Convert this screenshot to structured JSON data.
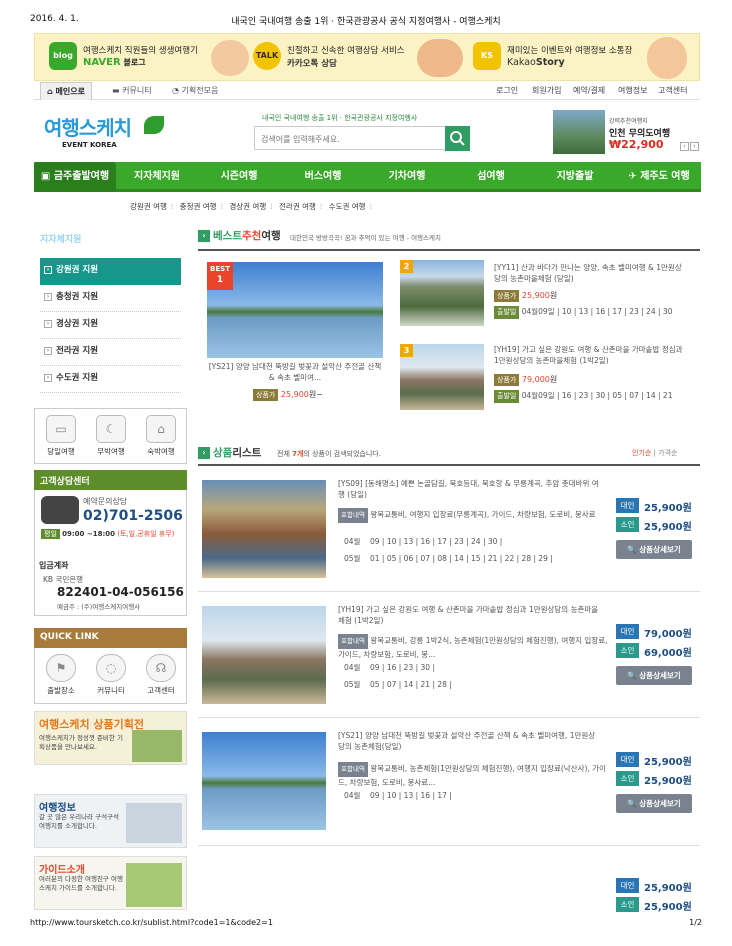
{
  "print": {
    "date": "2016. 4. 1.",
    "title": "내국인 국내여행 송출 1위 · 한국관광공사 공식 지정여행사 - 여행스케치",
    "url": "http://www.toursketch.co.kr/sublist.html?code1=1&code2=1",
    "page": "1/2"
  },
  "banner": [
    {
      "icon": "blog",
      "line1": "여행스케치 직원들의 생생여행기",
      "line2a": "NAVER",
      "line2b": " 블로그",
      "color": "#3aa82a"
    },
    {
      "icon": "TALK",
      "line1": "친절하고 신속한 여행상담 서비스",
      "line2a": "카카오톡",
      "line2b": " 상담",
      "color": "#222"
    },
    {
      "icon": "KS",
      "line1": "재미있는 이벤트와 여행정보 소통장",
      "line2a": "Kakao",
      "line2b": "Story",
      "color": "#222"
    }
  ],
  "topnav": {
    "tabs": [
      "메인으로",
      "커뮤니티",
      "기획전모음"
    ],
    "util": [
      "로그인",
      "회원가입",
      "예약/결제",
      "여행정보",
      "고객센터"
    ]
  },
  "logo": {
    "main": "여행스케치",
    "sub": "EVENT KOREA"
  },
  "search": {
    "caption": "내국인 국내여행 송출 1위 · 한국관광공사 지정여행사",
    "placeholder": "검색어를 입력해주세요."
  },
  "ad": {
    "line1": "강력추천여행지",
    "line2": "인천 무의도여행",
    "price": "₩22,900"
  },
  "gnav": [
    "금주출발여행",
    "지자체지원",
    "시즌여행",
    "버스여행",
    "기차여행",
    "섬여행",
    "지방출발",
    "제주도 여행"
  ],
  "subnav": [
    "강원권 여행",
    "충청권 여행",
    "경상권 여행",
    "전라권 여행",
    "수도권 여행"
  ],
  "lnb": {
    "title": "지자체지원",
    "items": [
      "강원권 지원",
      "충청권 지원",
      "경상권 지원",
      "전라권 지원",
      "수도권 지원"
    ]
  },
  "quick3": [
    "당일여행",
    "무박여행",
    "숙박여행"
  ],
  "cs": {
    "head": "고객상담센터",
    "label": "예약문의상담",
    "phone": "02)701-2506",
    "hours_tag": "평일",
    "hours": "09:00 ~18:00",
    "hours_note": "(토,일,공휴일 휴무)",
    "bank_title": "입금계좌",
    "bank": "KB 국민은행",
    "account": "822401-04-056156",
    "holder": "예금주 : (주)여행스케치여행사"
  },
  "quicklink": {
    "head": "QUICK LINK",
    "items": [
      "출발장소",
      "커뮤니티",
      "고객센터"
    ]
  },
  "promos": [
    {
      "title": "여행스케치 상품기획전",
      "desc": "여행스케치가 정성껏 준비한 기획상품을 만나보세요."
    },
    {
      "title": "여행정보",
      "desc": "갈 곳 많은 우리나라 구석구석 여행지를 소개합니다."
    },
    {
      "title": "가이드소개",
      "desc": "여러분의 다정한 여행친구 여행스케치 가이드를 소개합니다."
    }
  ],
  "best": {
    "title_a": "베스트",
    "title_b": "추천",
    "title_c": "여행",
    "subtitle": "대한민국 방방곡곡! 꿈과 추억이 있는 여행 - 여행스케치",
    "big": {
      "ribbon": "BEST",
      "rank": "1",
      "title": "[YS21] 양양 남대천 뚝방길 벚꽃과 설악산 주전골 산책 & 속초 벨미여...",
      "tag": "상품가",
      "price": "25,900",
      "unit": "원~"
    },
    "items": [
      {
        "rank": "2",
        "title": "[YY11] 산과 바다가 만나는 양양, 속초 벨미여행 & 1만원상당의 농촌마을체험 (당일)",
        "tag": "상품가",
        "price": "25,900",
        "unit": "원",
        "dep_tag": "출발일",
        "month": "04월09일",
        "days": "10 | 13 | 16 | 17 | 23 | 24 | 30"
      },
      {
        "rank": "3",
        "title": "[YH19] 가고 싶은 강원도 여행 & 산촌마을 가마솥밥 정심과 1만원상당의 농촌마을체험 (1박2일)",
        "tag": "상품가",
        "price": "79,000",
        "unit": "원",
        "dep_tag": "출발일",
        "month": "04월09일",
        "days": "16 | 23 | 30 | 05 | 07 | 14 | 21"
      }
    ]
  },
  "plist": {
    "title_a": "상품",
    "title_b": "리스트",
    "summary_pre": "전체 ",
    "count": "7개",
    "summary_post": "의 상품이 검색되었습니다.",
    "sort": [
      "인기순",
      "가격순"
    ],
    "include_tag": "포함내역",
    "adult": "대인",
    "child": "소인",
    "detail": "상품상세보기",
    "rows": [
      {
        "title": "[YS09] [동해명소] 예쁜 논골담길, 묵호등대, 묵호항 & 무릉계곡, 추암 촛대바위 여행 (당일)",
        "include": "왕복교통비, 여행지 입장료(무릉계곡), 가이드, 차량보험, 도로비, 봉사료",
        "dates": [
          {
            "m": "04월",
            "d": "09 | 10 | 13 | 16 | 17 | 23 | 24 | 30 |"
          },
          {
            "m": "05월",
            "d": "01 | 05 | 06 | 07 | 08 | 14 | 15 | 21 | 22 | 28 | 29 |"
          }
        ],
        "adult": "25,900원",
        "child": "25,900원"
      },
      {
        "title": "[YH19] 가고 싶은 강원도 여행 & 산촌마을 가마솥밥 정심과 1만원상당의 농촌마을체험 (1박2일)",
        "include": "왕복교통비, 강릉 1박2식, 농촌체험(1만원상당의 체험진행), 여행지 입장료, 가이드, 차량보험, 도로비, 봉...",
        "dates": [
          {
            "m": "04월",
            "d": "09 | 16 | 23 | 30 |"
          },
          {
            "m": "05월",
            "d": "05 | 07 | 14 | 21 | 28 |"
          }
        ],
        "adult": "79,000원",
        "child": "69,000원"
      },
      {
        "title": "[YS21] 양양 남대천 뚝방길 벚꽃과 설악산 주전골 산책 & 속초 벨미여행, 1만원상당의 농촌체험(당일)",
        "include": "왕복교통비, 농촌체험(1만원상당의 체험진행), 여행지 입장료(낙산사), 가이드, 차량보험, 도로비, 봉사료...",
        "dates": [
          {
            "m": "04월",
            "d": "09 | 10 | 13 | 16 | 17 |"
          }
        ],
        "adult": "25,900원",
        "child": "25,900원"
      },
      {
        "adult": "25,900원",
        "child": "25,900원"
      }
    ]
  }
}
